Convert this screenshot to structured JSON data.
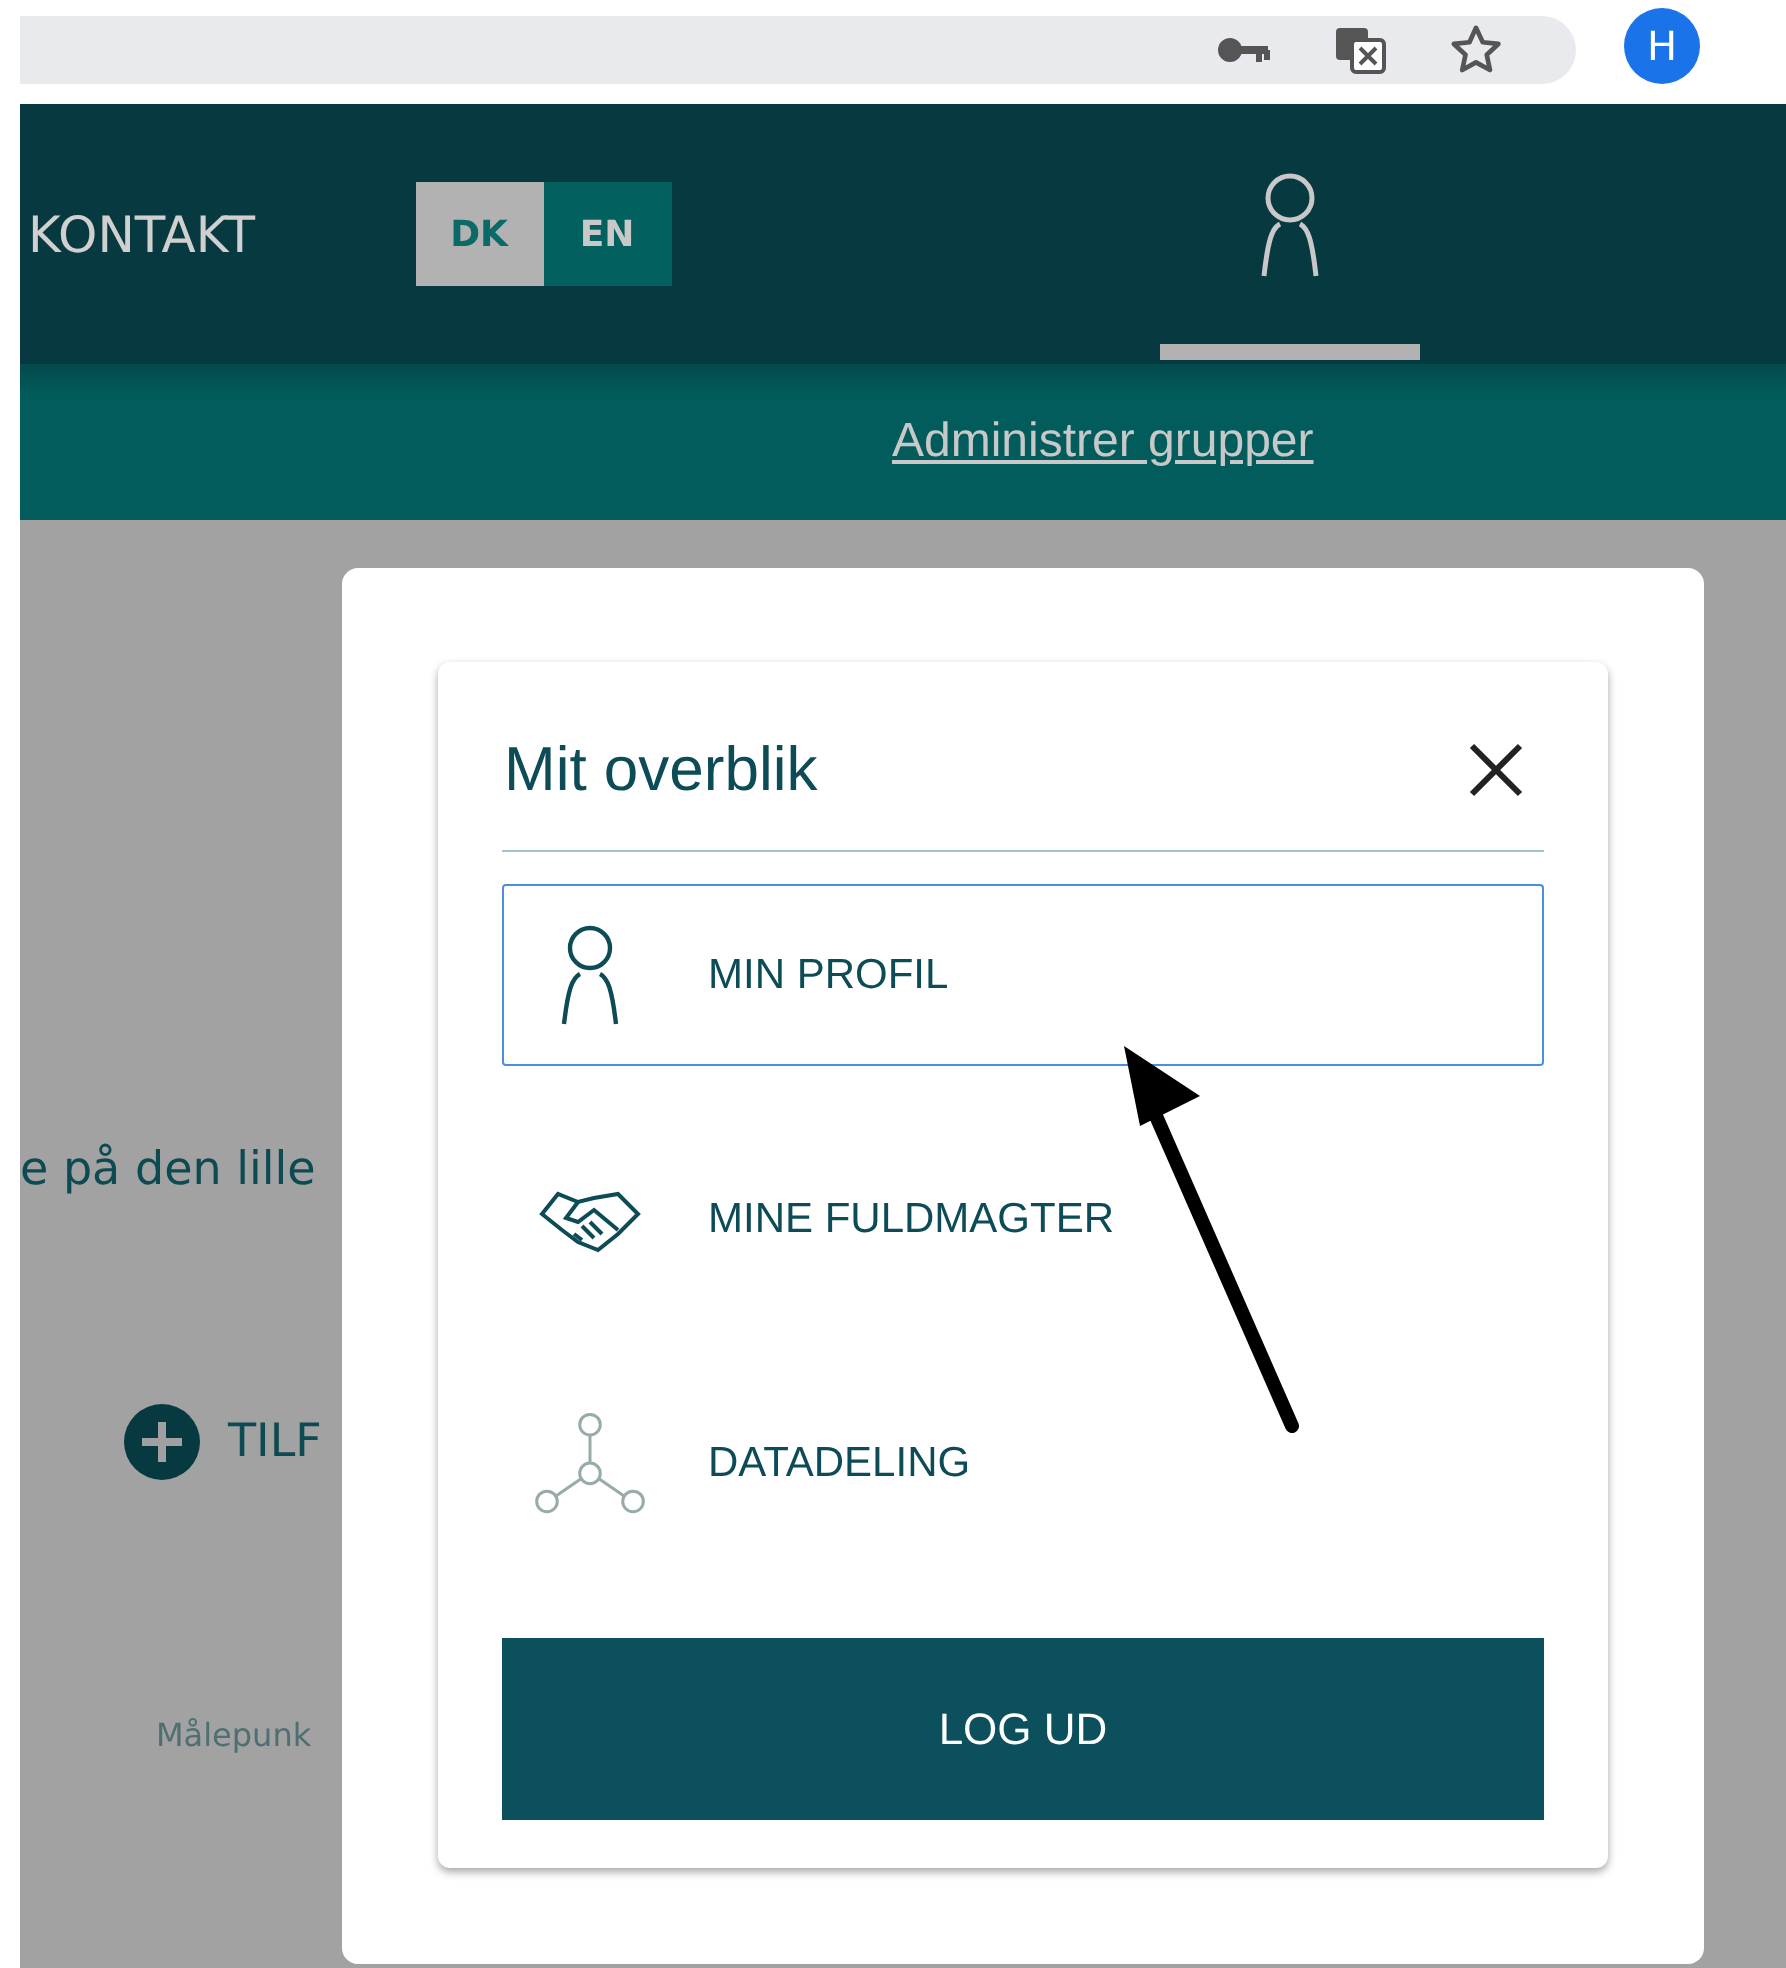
{
  "browser": {
    "avatar": "H"
  },
  "header": {
    "nav_label": "KONTAKT",
    "languages": [
      {
        "label": "DK",
        "selected": true
      },
      {
        "label": "EN",
        "selected": false
      }
    ]
  },
  "subnav": {
    "link": "Administrer grupper"
  },
  "background": {
    "text": "e på den lille",
    "add_button": "TILF",
    "caption": "Målepunk"
  },
  "dialog": {
    "title": "Mit overblik",
    "items": [
      {
        "kind": "profile",
        "label": "MIN PROFIL",
        "selected": true
      },
      {
        "kind": "handshake",
        "label": "MINE FULDMAGTER",
        "selected": false
      },
      {
        "kind": "network",
        "label": "DATADELING",
        "selected": false
      }
    ],
    "logout": "LOG UD"
  }
}
